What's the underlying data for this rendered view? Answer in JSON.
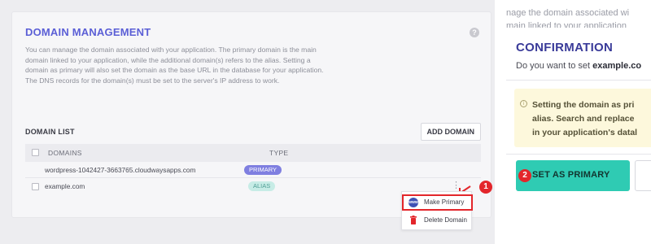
{
  "domain_management": {
    "title": "DOMAIN MANAGEMENT",
    "help_glyph": "?",
    "description": "You can manage the domain associated with your application. The primary domain is the main domain linked to your application, while the additional domain(s) refers to the alias. Setting a domain as primary will also set the domain as the base URL in the database for your application. The DNS records for the domain(s) must be set to the server's IP address to work."
  },
  "domain_list": {
    "label": "DOMAIN LIST",
    "add_button": "ADD DOMAIN",
    "columns": [
      "DOMAINS",
      "TYPE"
    ],
    "rows": [
      {
        "domain": "wordpress-1042427-3663765.cloudwaysapps.com",
        "type": "PRIMARY"
      },
      {
        "domain": "example.com",
        "type": "ALIAS"
      }
    ],
    "more_glyph": "⋮"
  },
  "context_menu": {
    "items": [
      {
        "label": "Make Primary",
        "icon": "www-icon"
      },
      {
        "label": "Delete Domain",
        "icon": "trash-icon"
      }
    ]
  },
  "steps": {
    "one": "1",
    "two": "2"
  },
  "confirmation": {
    "bg_line_1": "nage the domain associated wi",
    "bg_line_2": "main linked to your application",
    "title": "CONFIRMATION",
    "question_prefix": "Do you want to set ",
    "question_domain": "example.co",
    "warning_icon": "i",
    "warning_lines": [
      "Setting the domain as pri",
      "alias. Search and replace",
      "in your application's datal"
    ],
    "set_button": "SET AS PRIMARY"
  },
  "colors": {
    "accent": "#5b5fd6",
    "primary_badge": "#7f7fe0",
    "alias_badge": "#c7ece6",
    "step_red": "#e3262b",
    "teal_button": "#2fcbb3",
    "warning_bg": "#fdf8dc"
  }
}
